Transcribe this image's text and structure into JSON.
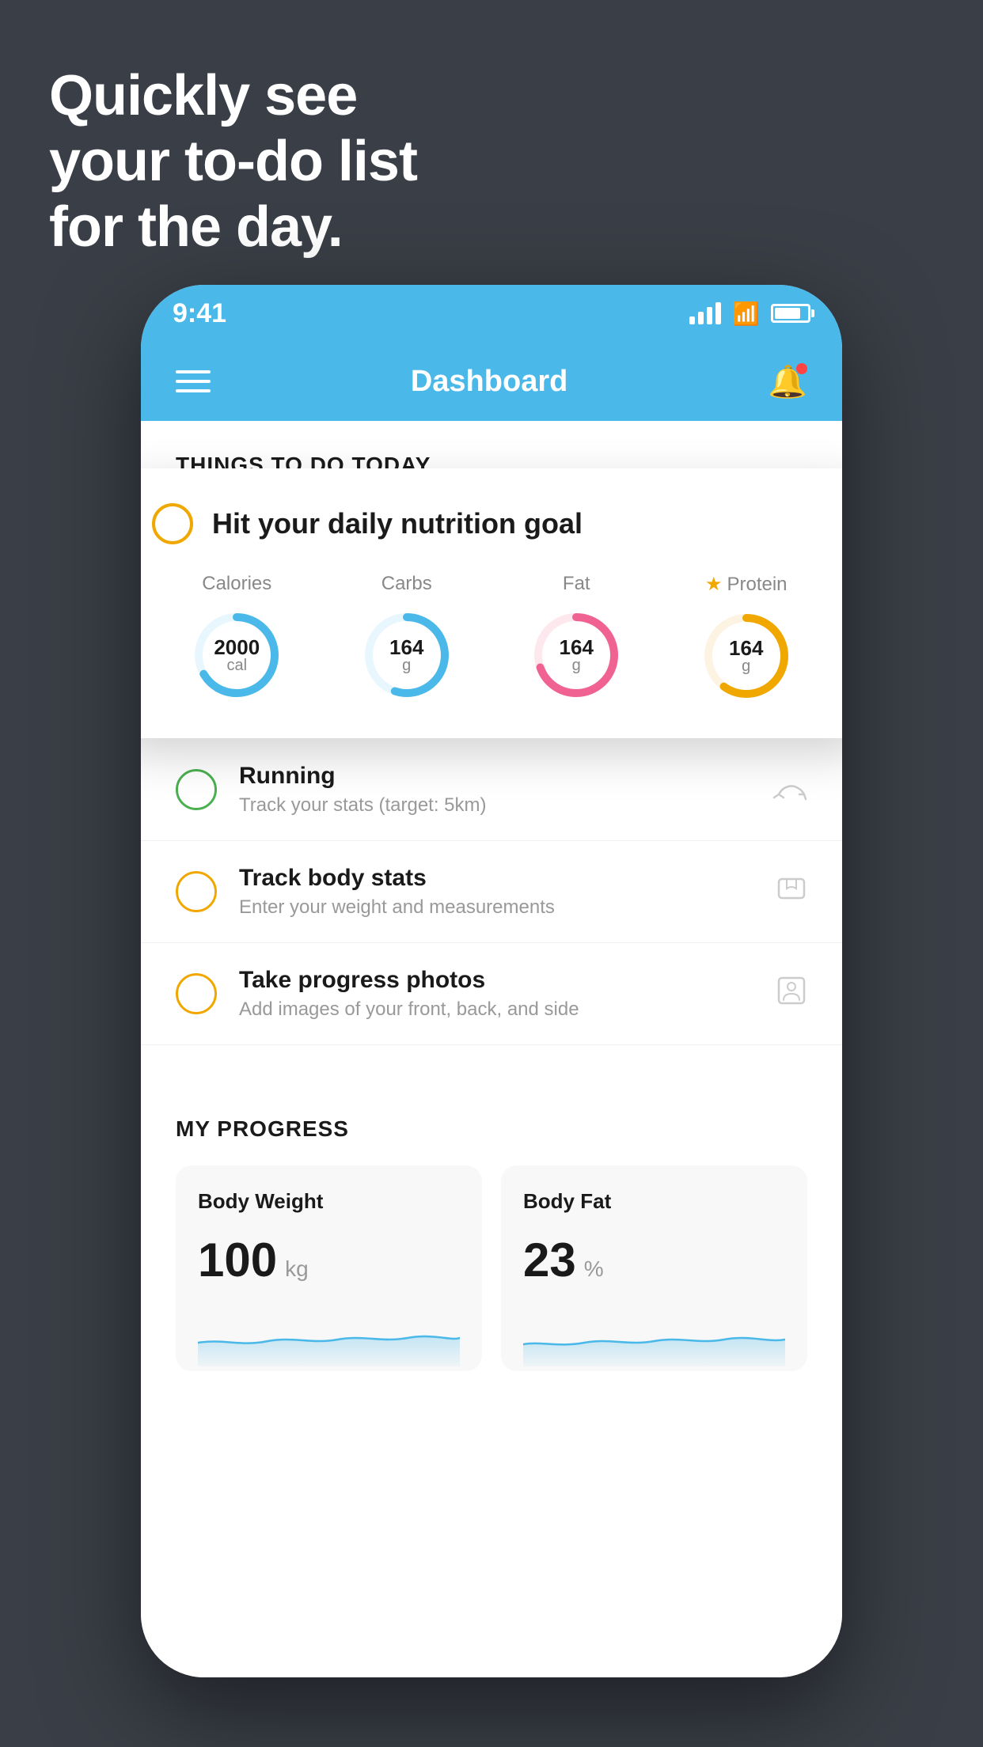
{
  "background": {
    "headline_line1": "Quickly see",
    "headline_line2": "your to-do list",
    "headline_line3": "for the day."
  },
  "phone": {
    "status_bar": {
      "time": "9:41"
    },
    "header": {
      "title": "Dashboard"
    },
    "section_header": "THINGS TO DO TODAY",
    "floating_card": {
      "title": "Hit your daily nutrition goal",
      "nutrition": [
        {
          "label": "Calories",
          "value": "2000",
          "unit": "cal",
          "color": "#4ab8e8",
          "percent": 65
        },
        {
          "label": "Carbs",
          "value": "164",
          "unit": "g",
          "color": "#4ab8e8",
          "percent": 55
        },
        {
          "label": "Fat",
          "value": "164",
          "unit": "g",
          "color": "#f06292",
          "percent": 70
        },
        {
          "label": "Protein",
          "value": "164",
          "unit": "g",
          "color": "#f0a800",
          "percent": 60,
          "starred": true
        }
      ]
    },
    "todo_items": [
      {
        "title": "Running",
        "subtitle": "Track your stats (target: 5km)",
        "circle_color": "green",
        "icon": "🥾"
      },
      {
        "title": "Track body stats",
        "subtitle": "Enter your weight and measurements",
        "circle_color": "yellow",
        "icon": "⚖"
      },
      {
        "title": "Take progress photos",
        "subtitle": "Add images of your front, back, and side",
        "circle_color": "yellow",
        "icon": "👤"
      }
    ],
    "progress": {
      "section_title": "MY PROGRESS",
      "cards": [
        {
          "title": "Body Weight",
          "value": "100",
          "unit": "kg"
        },
        {
          "title": "Body Fat",
          "value": "23",
          "unit": "%"
        }
      ]
    }
  }
}
